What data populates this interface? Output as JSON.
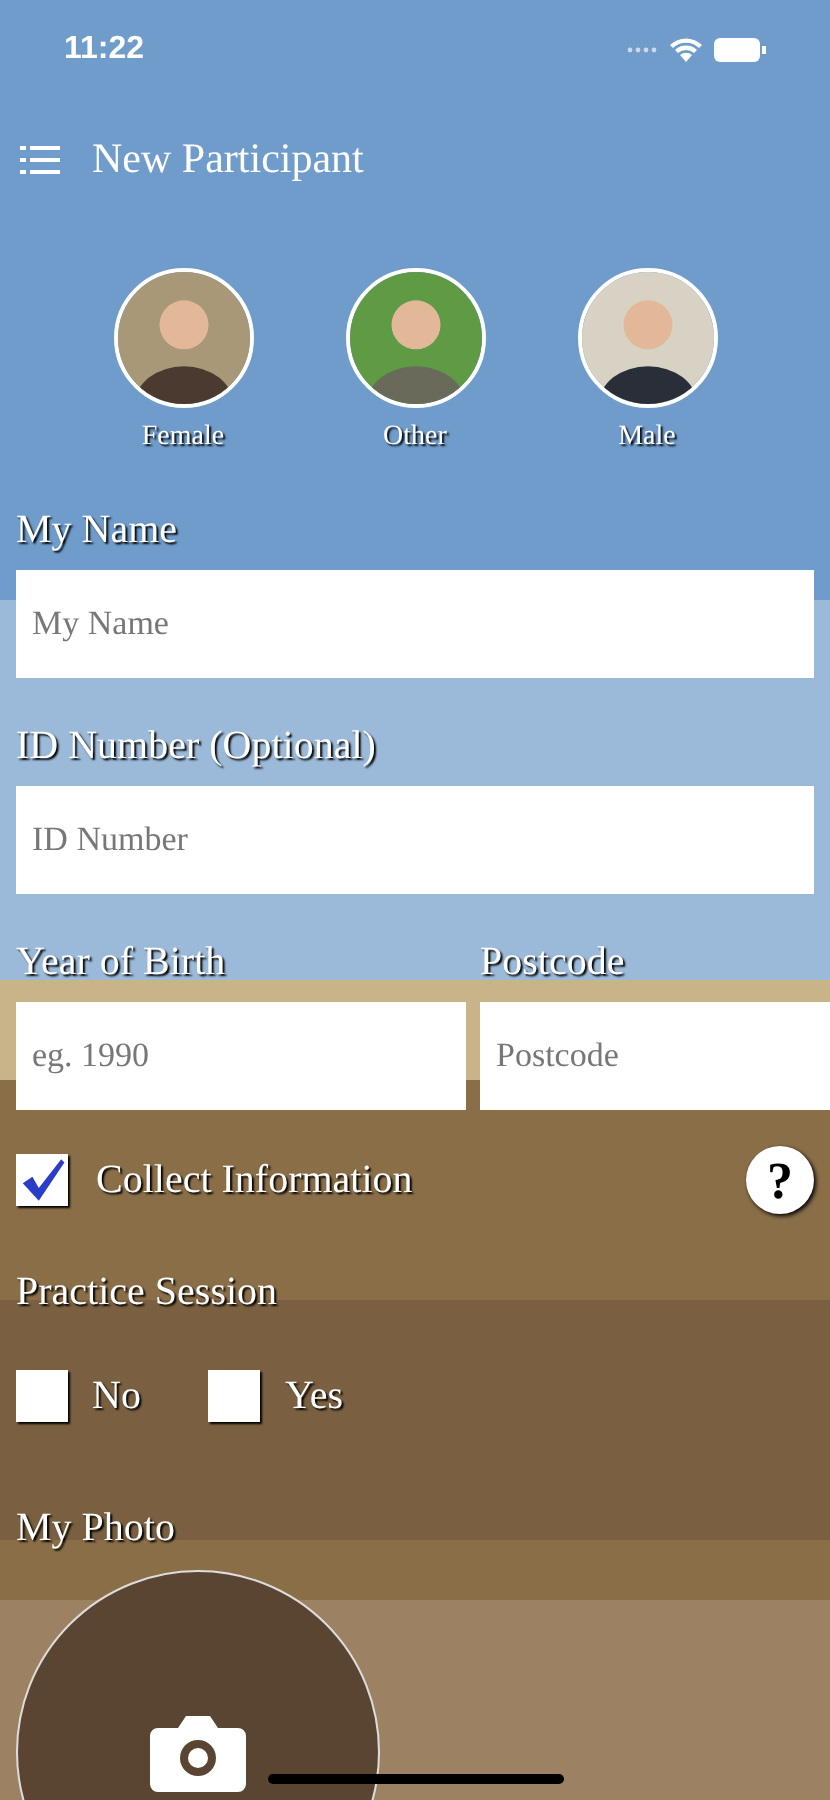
{
  "status_bar": {
    "time": "11:22"
  },
  "header": {
    "title": "New Participant"
  },
  "genders": [
    {
      "label": "Female"
    },
    {
      "label": "Other"
    },
    {
      "label": "Male"
    }
  ],
  "name_field": {
    "label": "My Name",
    "placeholder": "My Name"
  },
  "id_field": {
    "label": "ID Number (Optional)",
    "placeholder": "ID Number"
  },
  "birth_field": {
    "label": "Year of Birth",
    "placeholder": "eg. 1990"
  },
  "postcode_field": {
    "label": "Postcode",
    "placeholder": "Postcode"
  },
  "collect": {
    "label": "Collect Information",
    "checked": true,
    "help": "?"
  },
  "practice": {
    "label": "Practice Session",
    "options": [
      {
        "label": "No",
        "checked": false
      },
      {
        "label": "Yes",
        "checked": false
      }
    ]
  },
  "photo": {
    "label": "My Photo"
  }
}
